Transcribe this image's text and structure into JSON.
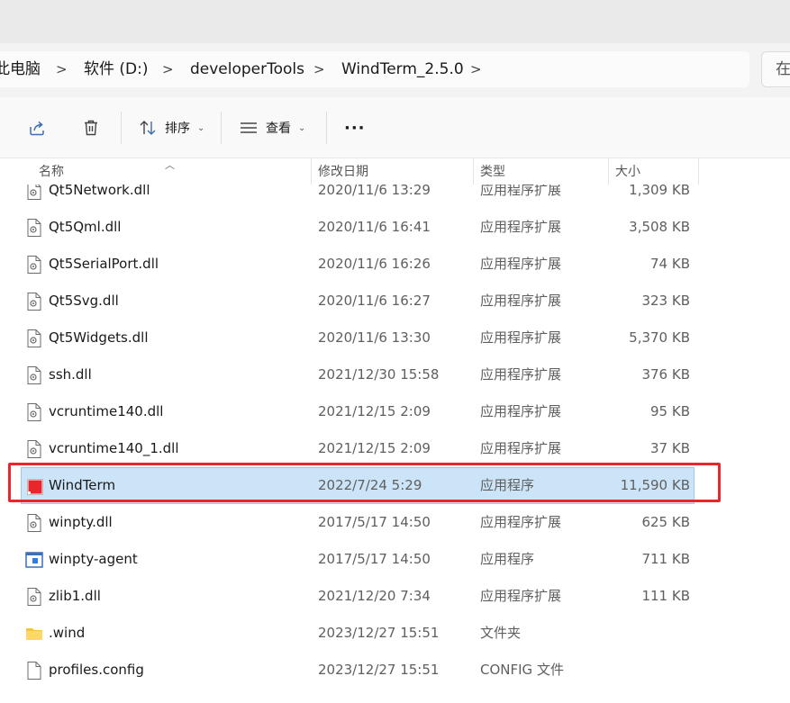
{
  "breadcrumb": {
    "items": [
      "此电脑",
      "软件 (D:)",
      "developerTools",
      "WindTerm_2.5.0"
    ],
    "separator": ">"
  },
  "search": {
    "placeholder_fragment": "在"
  },
  "toolbar": {
    "share_icon": "share-icon",
    "delete_icon": "trash-icon",
    "sort_label": "排序",
    "view_label": "查看",
    "more_label": "···"
  },
  "columns": {
    "name": "名称",
    "date": "修改日期",
    "type": "类型",
    "size": "大小"
  },
  "files": [
    {
      "name": "Qt5Network.dll",
      "date": "2020/11/6 13:29",
      "type": "应用程序扩展",
      "size": "1,309 KB",
      "icon": "dll-file-icon"
    },
    {
      "name": "Qt5Qml.dll",
      "date": "2020/11/6 16:41",
      "type": "应用程序扩展",
      "size": "3,508 KB",
      "icon": "dll-file-icon"
    },
    {
      "name": "Qt5SerialPort.dll",
      "date": "2020/11/6 16:26",
      "type": "应用程序扩展",
      "size": "74 KB",
      "icon": "dll-file-icon"
    },
    {
      "name": "Qt5Svg.dll",
      "date": "2020/11/6 16:27",
      "type": "应用程序扩展",
      "size": "323 KB",
      "icon": "dll-file-icon"
    },
    {
      "name": "Qt5Widgets.dll",
      "date": "2020/11/6 13:30",
      "type": "应用程序扩展",
      "size": "5,370 KB",
      "icon": "dll-file-icon"
    },
    {
      "name": "ssh.dll",
      "date": "2021/12/30 15:58",
      "type": "应用程序扩展",
      "size": "376 KB",
      "icon": "dll-file-icon"
    },
    {
      "name": "vcruntime140.dll",
      "date": "2021/12/15 2:09",
      "type": "应用程序扩展",
      "size": "95 KB",
      "icon": "dll-file-icon"
    },
    {
      "name": "vcruntime140_1.dll",
      "date": "2021/12/15 2:09",
      "type": "应用程序扩展",
      "size": "37 KB",
      "icon": "dll-file-icon"
    },
    {
      "name": "WindTerm",
      "date": "2022/7/24 5:29",
      "type": "应用程序",
      "size": "11,590 KB",
      "icon": "windterm-app-icon",
      "selected": true
    },
    {
      "name": "winpty.dll",
      "date": "2017/5/17 14:50",
      "type": "应用程序扩展",
      "size": "625 KB",
      "icon": "dll-file-icon"
    },
    {
      "name": "winpty-agent",
      "date": "2017/5/17 14:50",
      "type": "应用程序",
      "size": "711 KB",
      "icon": "exe-app-icon"
    },
    {
      "name": "zlib1.dll",
      "date": "2021/12/20 7:34",
      "type": "应用程序扩展",
      "size": "111 KB",
      "icon": "dll-file-icon"
    },
    {
      "name": ".wind",
      "date": "2023/12/27 15:51",
      "type": "文件夹",
      "size": "",
      "icon": "folder-icon"
    },
    {
      "name": "profiles.config",
      "date": "2023/12/27 15:51",
      "type": "CONFIG 文件",
      "size": "",
      "icon": "config-file-icon"
    }
  ],
  "colors": {
    "selection_bg": "#cce4f7",
    "selection_border": "#99c9ef",
    "highlight_box": "#e8262b",
    "windterm_icon": "#e8262b",
    "folder": "#f5c242"
  }
}
